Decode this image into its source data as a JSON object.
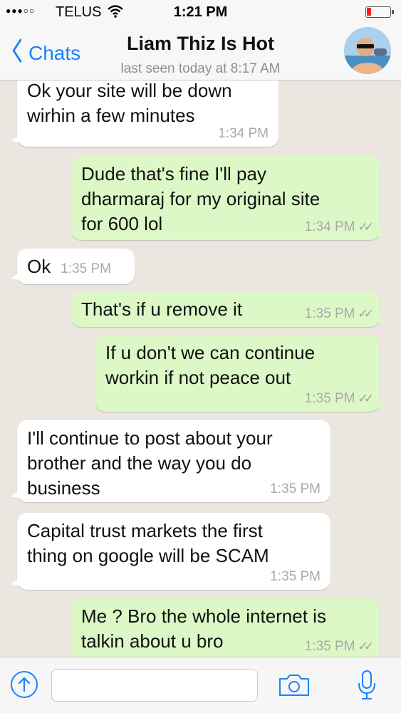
{
  "status_bar": {
    "carrier": "TELUS",
    "time": "1:21 PM",
    "battery_level": 0.2
  },
  "header": {
    "back_label": "Chats",
    "contact_name": "Liam Thiz Is Hot",
    "last_seen": "last seen today at 8:17 AM"
  },
  "messages": [
    {
      "direction": "in",
      "text": "Ok your site will be down\nwirhin a few minutes",
      "time": "1:34 PM"
    },
    {
      "direction": "out",
      "text": "Dude that's fine I'll pay\ndharmaraj for my original site\nfor 600 lol",
      "time": "1:34 PM"
    },
    {
      "direction": "in",
      "text": "Ok",
      "time": "1:35 PM"
    },
    {
      "direction": "out",
      "text": "That's if u remove it",
      "time": "1:35 PM"
    },
    {
      "direction": "out",
      "text": "If u don't we can continue\nworkin if not peace out",
      "time": "1:35 PM"
    },
    {
      "direction": "in",
      "text": "I'll continue to post about your\nbrother and the way you do\nbusiness",
      "time": "1:35 PM"
    },
    {
      "direction": "in",
      "text": "Capital trust markets the first\nthing on google will be SCAM",
      "time": "1:35 PM"
    },
    {
      "direction": "out",
      "text": "Me ? Bro the whole internet is\ntalkin about u bro",
      "time": "1:35 PM"
    }
  ],
  "input": {
    "placeholder": ""
  },
  "colors": {
    "accent": "#1a82fb",
    "outgoing_bubble": "#dcf8c6",
    "incoming_bubble": "#ffffff",
    "chat_background": "#ebe6df"
  },
  "icons": {
    "attach": "upload-circle-icon",
    "camera": "camera-icon",
    "mic": "microphone-icon",
    "read_receipt": "double-check-icon"
  }
}
